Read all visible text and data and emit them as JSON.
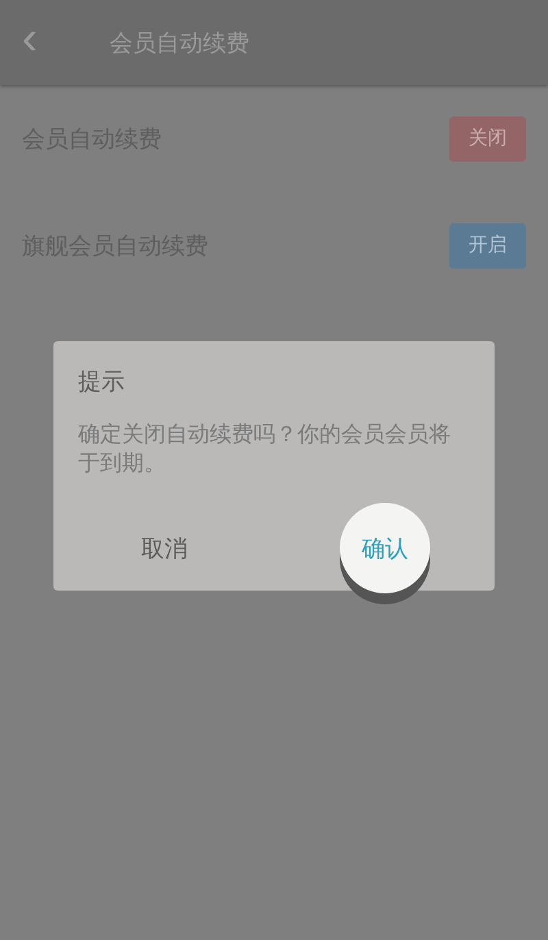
{
  "header": {
    "back": "‹",
    "title": "会员自动续费"
  },
  "settings": [
    {
      "label": "会员自动续费",
      "button": "关闭",
      "on": true
    },
    {
      "label": "旗舰会员自动续费",
      "button": "开启",
      "on": false
    }
  ],
  "dialog": {
    "title": "提示",
    "message": "确定关闭自动续费吗？你的会员会员将于到期。",
    "buttons": [
      {
        "label": "取消",
        "kind": "cancel",
        "pressed": false
      },
      {
        "label": "确认",
        "kind": "confirm",
        "pressed": true
      }
    ]
  }
}
